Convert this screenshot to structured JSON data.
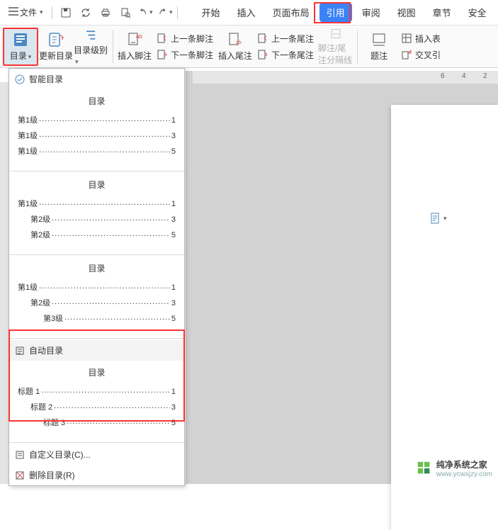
{
  "menu": {
    "file": "文件",
    "tabs": [
      "开始",
      "插入",
      "页面布局",
      "引用",
      "审阅",
      "视图",
      "章节",
      "安全"
    ]
  },
  "qat_icons": [
    "menu-icon",
    "save-icon",
    "refresh-icon",
    "print-icon",
    "print-preview-icon",
    "undo-icon",
    "redo-icon"
  ],
  "ribbon": {
    "toc_button": "目录",
    "update_toc": "更新目录",
    "toc_level": "目录级别",
    "insert_footnote": "插入脚注",
    "prev_footnote": "上一条脚注",
    "next_footnote": "下一条脚注",
    "insert_endnote": "插入尾注",
    "prev_endnote": "上一条尾注",
    "next_endnote": "下一条尾注",
    "footnote_endnote_sep": "脚注/尾注分隔线",
    "caption": "题注",
    "cross_ref": "交叉引",
    "insert_table": "插入表"
  },
  "dropdown": {
    "smart_toc": "智能目录",
    "preview_heading": "目录",
    "previews": [
      {
        "lines": [
          {
            "label": "第1级",
            "indent": 0,
            "page": "1"
          },
          {
            "label": "第1级",
            "indent": 0,
            "page": "3"
          },
          {
            "label": "第1级",
            "indent": 0,
            "page": "5"
          }
        ]
      },
      {
        "lines": [
          {
            "label": "第1级",
            "indent": 0,
            "page": "1"
          },
          {
            "label": "第2级",
            "indent": 1,
            "page": "3"
          },
          {
            "label": "第2级",
            "indent": 1,
            "page": "5"
          }
        ]
      },
      {
        "lines": [
          {
            "label": "第1级",
            "indent": 0,
            "page": "1"
          },
          {
            "label": "第2级",
            "indent": 1,
            "page": "3"
          },
          {
            "label": "第3级",
            "indent": 2,
            "page": "5"
          }
        ]
      }
    ],
    "auto_toc": "自动目录",
    "auto_preview": {
      "lines": [
        {
          "label": "标题 1",
          "indent": 0,
          "page": "1"
        },
        {
          "label": "标题 2",
          "indent": 1,
          "page": "3"
        },
        {
          "label": "标题 3",
          "indent": 2,
          "page": "5"
        }
      ]
    },
    "custom_toc": "自定义目录(C)...",
    "delete_toc": "删除目录(R)"
  },
  "ruler": {
    "marks": [
      "6",
      "4",
      "2",
      "2"
    ]
  },
  "watermark": {
    "title": "纯净系统之家",
    "url": "www.ycwxjzy.com"
  }
}
